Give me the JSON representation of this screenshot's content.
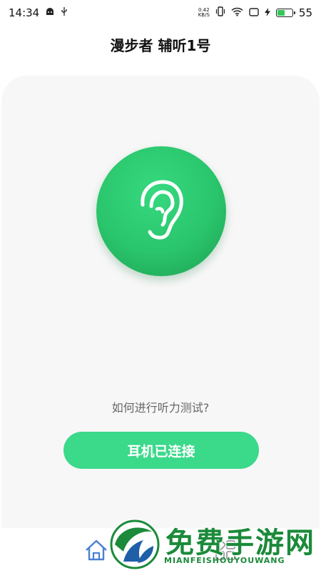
{
  "status_bar": {
    "time": "14:34",
    "net_speed_value": "0.42",
    "net_speed_unit": "KB/S",
    "battery": "55",
    "battery_level": 0.55
  },
  "header": {
    "title": "漫步者 辅听1号"
  },
  "main": {
    "question": "如何进行听力测试?",
    "connect_button_label": "耳机已连接"
  },
  "watermark": {
    "title": "免费手游网",
    "subtitle": "MIANFEISHOUYOUWANG"
  },
  "colors": {
    "accent": "#3bd98a",
    "circle": "#2ac56c",
    "watermark": "#1b8a3a"
  },
  "icons": [
    "android-icon",
    "usb-icon",
    "vibrate-icon",
    "wifi-icon",
    "screen-icon",
    "charging-icon",
    "ear-icon",
    "home-icon",
    "grid-icon"
  ]
}
